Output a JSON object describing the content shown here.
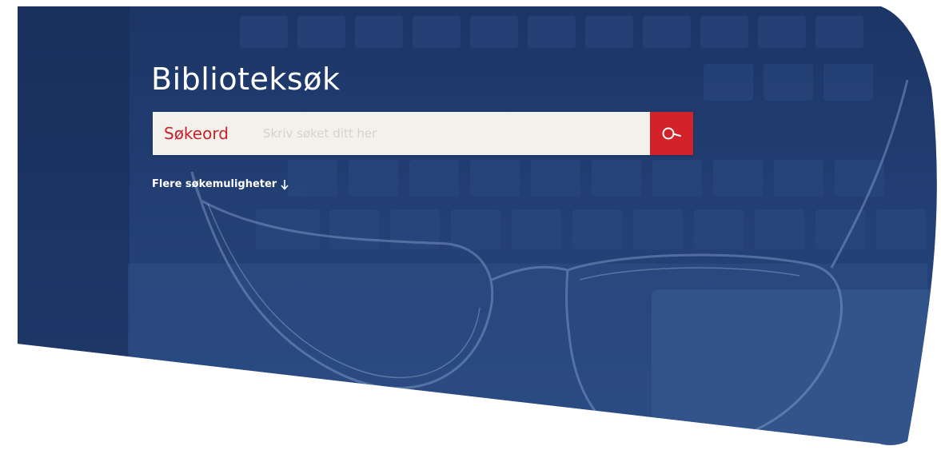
{
  "hero": {
    "title": "Biblioteksøk"
  },
  "search": {
    "label": "Søkeord",
    "placeholder": "Skriv søket ditt her",
    "value": "",
    "button_icon": "search-icon"
  },
  "more_options": {
    "label": "Flere søkemuligheter",
    "icon": "arrow-down-icon"
  },
  "colors": {
    "hero_blue": "#1f3a6e",
    "accent_red": "#d2232a",
    "label_red": "#c8202c",
    "search_bg": "#f3f1ec"
  }
}
